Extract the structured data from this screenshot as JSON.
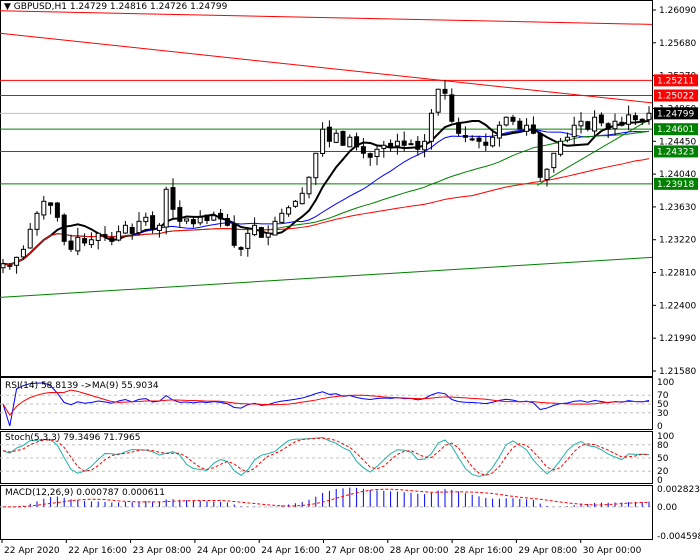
{
  "header": {
    "symbol": "GBPUSD,H1",
    "ohlc": "1.24729 1.24816 1.24726 1.24799"
  },
  "price_axis": {
    "ticks": [
      "1.26090",
      "1.25680",
      "1.25270",
      "1.24860",
      "1.24450",
      "1.24040",
      "1.23630",
      "1.23220",
      "1.22810",
      "1.22400",
      "1.21990",
      "1.21580"
    ],
    "max": 1.2609,
    "min": 1.2158
  },
  "price_tags": [
    {
      "text": "1.25211",
      "value": 1.25211,
      "color": "#ff0000"
    },
    {
      "text": "1.25022",
      "value": 1.25022,
      "color": "#ff0000"
    },
    {
      "text": "1.24799",
      "value": 1.24799,
      "color": "#000000"
    },
    {
      "text": "1.24601",
      "value": 1.24601,
      "color": "#008000"
    },
    {
      "text": "1.24323",
      "value": 1.24323,
      "color": "#008000"
    },
    {
      "text": "1.23918",
      "value": 1.23918,
      "color": "#008000"
    }
  ],
  "trend_lines": [
    {
      "color": "#ff0000",
      "from": [
        0,
        1.2608
      ],
      "to": [
        95,
        1.2591
      ]
    },
    {
      "color": "#ff0000",
      "from": [
        0,
        1.258
      ],
      "to": [
        95,
        1.2493
      ]
    },
    {
      "color": "#008000",
      "from": [
        0,
        1.225
      ],
      "to": [
        95,
        1.23
      ]
    },
    {
      "color": "#008000",
      "from": [
        79,
        1.239
      ],
      "to": [
        95,
        1.2474
      ]
    }
  ],
  "chart_data": {
    "type": "candlestick",
    "closes": [
      1.2292,
      1.229,
      1.23,
      1.231,
      1.2335,
      1.2355,
      1.237,
      1.2365,
      1.235,
      1.232,
      1.231,
      1.2325,
      1.2318,
      1.2322,
      1.233,
      1.2326,
      1.232,
      1.2332,
      1.234,
      1.233,
      1.2345,
      1.235,
      1.2335,
      1.234,
      1.2385,
      1.236,
      1.2345,
      1.2348,
      1.2342,
      1.235,
      1.2346,
      1.2352,
      1.2348,
      1.234,
      1.2315,
      1.231,
      1.233,
      1.234,
      1.2325,
      1.233,
      1.2345,
      1.2355,
      1.2362,
      1.237,
      1.238,
      1.24,
      1.243,
      1.246,
      1.2445,
      1.2455,
      1.244,
      1.245,
      1.2438,
      1.243,
      1.2425,
      1.2435,
      1.244,
      1.2438,
      1.2445,
      1.244,
      1.2442,
      1.2435,
      1.2445,
      1.248,
      1.251,
      1.2505,
      1.247,
      1.2455,
      1.245,
      1.2448,
      1.2445,
      1.244,
      1.245,
      1.2465,
      1.2475,
      1.247,
      1.246,
      1.2465,
      1.2455,
      1.24,
      1.241,
      1.243,
      1.2445,
      1.245,
      1.2465,
      1.247,
      1.246,
      1.2475,
      1.2468,
      1.246,
      1.247,
      1.2465,
      1.2478,
      1.2472,
      1.247,
      1.248
    ],
    "ma_periods": [
      {
        "period": 8,
        "color": "#000000"
      },
      {
        "period": 20,
        "color": "#0000ff"
      },
      {
        "period": 40,
        "color": "#008000"
      },
      {
        "period": 70,
        "color": "#ff0000"
      }
    ],
    "time_labels": [
      "22 Apr 2020",
      "22 Apr 16:00",
      "23 Apr 08:00",
      "24 Apr 00:00",
      "24 Apr 16:00",
      "27 Apr 08:00",
      "28 Apr 00:00",
      "28 Apr 16:00",
      "29 Apr 08:00",
      "30 Apr 00:00"
    ]
  },
  "rsi": {
    "label": "RSI(14) 58.8139  ->MA(9) 55.9034",
    "ticks": [
      "100",
      "70",
      "50",
      "30",
      "0"
    ]
  },
  "stoch": {
    "label": "Stoch(5,3,3) 79.3496 71.7965",
    "ticks": [
      "100",
      "80",
      "50",
      "20",
      "0"
    ]
  },
  "macd": {
    "label": "MACD(12,26,9) 0.000787 0.000611",
    "ticks": [
      "0.002823",
      "0.00",
      "-0.004598"
    ]
  }
}
